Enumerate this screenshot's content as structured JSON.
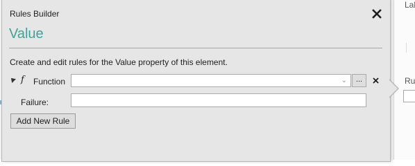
{
  "dialog": {
    "window_title": "Rules Builder",
    "heading": "Value",
    "description": "Create and edit rules for the Value property of this element.",
    "accent_color": "#3fa29a"
  },
  "rule": {
    "function_icon": "f",
    "function_label": "Function",
    "function_value": "",
    "ellipsis_label": "...",
    "failure_label": "Failure:",
    "failure_value": ""
  },
  "actions": {
    "add_rule_label": "Add New Rule"
  },
  "background": {
    "label_top": "Lab",
    "label_mid": "Ru"
  },
  "icons": {
    "close": "close-icon",
    "expander": "expander-icon",
    "function": "function-icon",
    "chevron": "chevron-down-icon",
    "remove": "remove-rule-icon"
  }
}
